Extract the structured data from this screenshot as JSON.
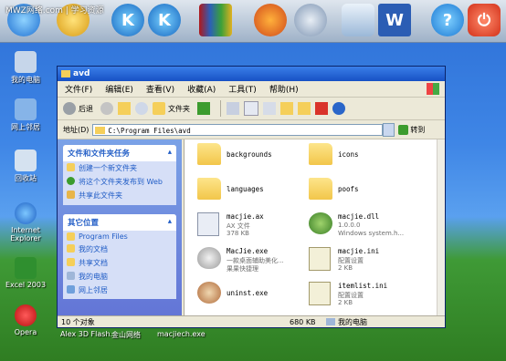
{
  "dock": {
    "overlay_text": "MWZ网络.com | 学习资源"
  },
  "desktop_icons": [
    {
      "label": "我的电脑"
    },
    {
      "label": "网上邻居"
    },
    {
      "label": "回收站"
    },
    {
      "label": "Internet Explorer"
    },
    {
      "label": "Excel 2003"
    },
    {
      "label": "Opera"
    }
  ],
  "bottom_labels": [
    "Alex 3D Flash...",
    "金山网络",
    "macjiech.exe"
  ],
  "window": {
    "title": "avd",
    "menu": [
      "文件(F)",
      "编辑(E)",
      "查看(V)",
      "收藏(A)",
      "工具(T)",
      "帮助(H)"
    ],
    "toolbar": {
      "back": "后退",
      "folders": "文件夹"
    },
    "address": {
      "label": "地址(D)",
      "value": "C:\\Program Files\\avd",
      "go": "转到"
    },
    "tasks": {
      "title": "文件和文件夹任务",
      "items": [
        "创建一个新文件夹",
        "将这个文件夹发布到 Web",
        "共享此文件夹"
      ]
    },
    "places": {
      "title": "其它位置",
      "items": [
        "Program Files",
        "我的文档",
        "共享文档",
        "我的电脑",
        "网上邻居"
      ]
    },
    "files": [
      {
        "name": "backgrounds",
        "sub1": "",
        "sub2": ""
      },
      {
        "name": "icons",
        "sub1": "",
        "sub2": ""
      },
      {
        "name": "languages",
        "sub1": "",
        "sub2": ""
      },
      {
        "name": "poofs",
        "sub1": "",
        "sub2": ""
      },
      {
        "name": "macjie.ax",
        "sub1": "AX 文件",
        "sub2": "378 KB"
      },
      {
        "name": "macjie.dll",
        "sub1": "1.0.0.0",
        "sub2": "Windows system.h..."
      },
      {
        "name": "MacJie.exe",
        "sub1": "一款桌面辅助美化...",
        "sub2": "果果快捷理"
      },
      {
        "name": "macjie.ini",
        "sub1": "配置设置",
        "sub2": "2 KB"
      },
      {
        "name": "uninst.exe",
        "sub1": "",
        "sub2": ""
      },
      {
        "name": "itemlist.ini",
        "sub1": "配置设置",
        "sub2": "2 KB"
      }
    ],
    "status": {
      "count": "10 个对象",
      "size": "680 KB",
      "location": "我的电脑"
    }
  }
}
